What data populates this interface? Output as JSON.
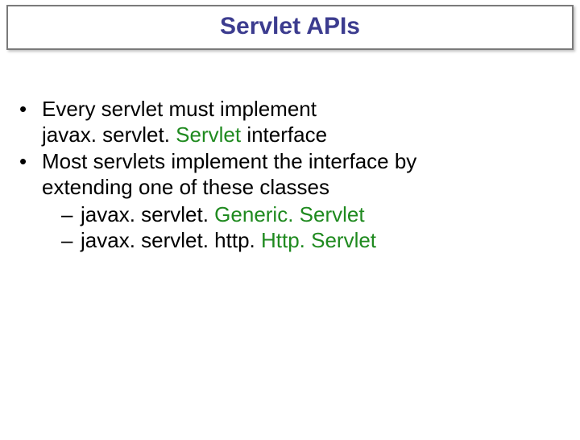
{
  "title": "Servlet APIs",
  "bullets": {
    "b1": {
      "mark": "•",
      "line1_pre": "Every servlet must implement ",
      "line2_pre": "javax. servlet. ",
      "line2_class": "Servlet",
      "line2_post": " interface"
    },
    "b2": {
      "mark": "•",
      "line1": "Most servlets implement the interface by ",
      "line2": "extending one of these classes",
      "sub1": {
        "dash": "–",
        "pre": "javax. servlet. ",
        "class": "Generic. Servlet"
      },
      "sub2": {
        "dash": "–",
        "pre": "javax. servlet. http. ",
        "class": "Http. Servlet"
      }
    }
  }
}
